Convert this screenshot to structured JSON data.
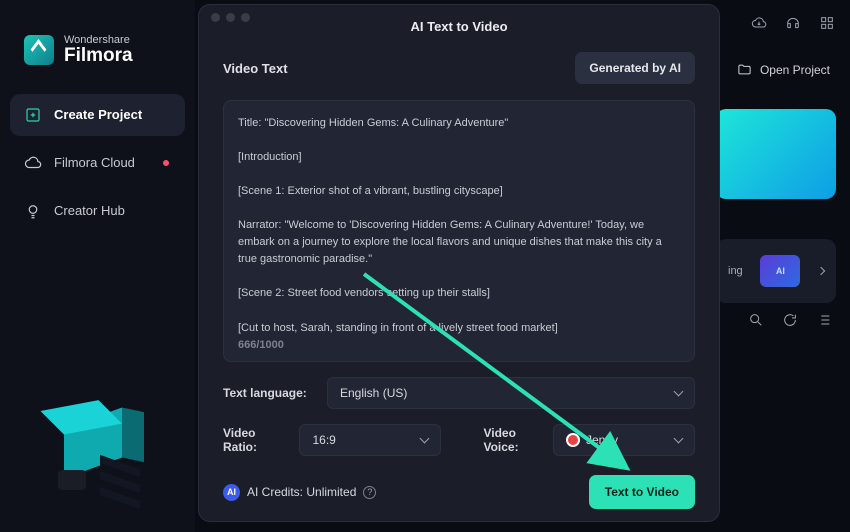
{
  "brand": {
    "small": "Wondershare",
    "big": "Filmora"
  },
  "sidebar": {
    "items": [
      {
        "label": "Create Project"
      },
      {
        "label": "Filmora Cloud"
      },
      {
        "label": "Creator Hub"
      }
    ]
  },
  "top_buttons": {
    "open_project": "Open Project"
  },
  "right_strip": {
    "template_label": "ing"
  },
  "dialog": {
    "title": "AI Text to Video",
    "section_label": "Video Text",
    "generate_btn": "Generated by AI",
    "script": "Title: \"Discovering Hidden Gems: A Culinary Adventure\"\n\n[Introduction]\n\n[Scene 1: Exterior shot of a vibrant, bustling cityscape]\n\nNarrator: \"Welcome to 'Discovering Hidden Gems: A Culinary Adventure!' Today, we embark on a journey to explore the local flavors and unique dishes that make this city a true gastronomic paradise.\"\n\n[Scene 2: Street food vendors setting up their stalls]\n\n[Cut to host, Sarah, standing in front of a lively street food market]\n\nSarah: \"Hey there, food enthusiasts! I'm Sarah, and today we're diving into the heart of this city's culinary scene. Join me as we uncover the hidden gems and flavors that define this vibrant food culture.\"",
    "char_count": "666/1000",
    "lang_label": "Text language:",
    "lang_value": "English (US)",
    "ratio_label": "Video Ratio:",
    "ratio_value": "16:9",
    "voice_label": "Video Voice:",
    "voice_value": "Jenny",
    "credits_label": "AI Credits: Unlimited",
    "ai_badge": "AI",
    "help": "?",
    "submit": "Text to Video"
  },
  "template_chip": "AI"
}
